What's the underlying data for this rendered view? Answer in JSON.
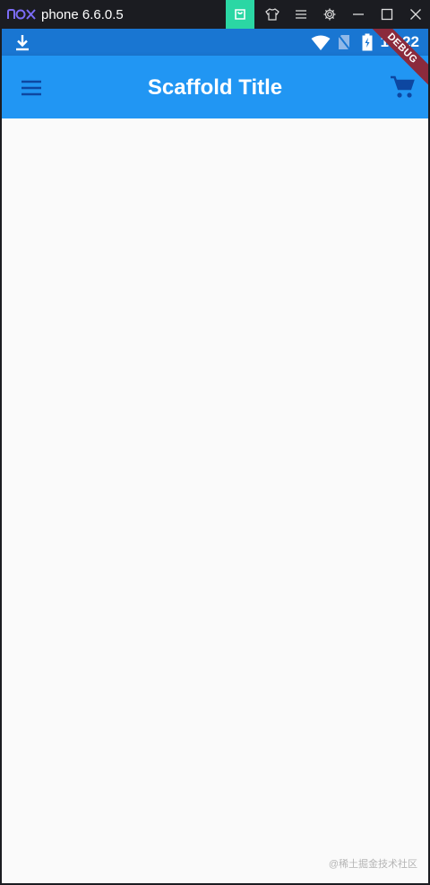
{
  "window": {
    "app_name": "nox",
    "title": "phone 6.6.0.5",
    "buttons": [
      "store-icon",
      "shirt-icon",
      "menu-icon",
      "gear-icon",
      "minimize-icon",
      "maximize-icon",
      "close-icon"
    ]
  },
  "statusbar": {
    "time": "10:22",
    "icons": [
      "download-icon",
      "wifi-icon",
      "no-sim-icon",
      "battery-charging-icon"
    ]
  },
  "appbar": {
    "title": "Scaffold Title",
    "leading_icon": "menu-icon",
    "action_icon": "shopping-cart-icon",
    "debug_banner": "DEBUG"
  },
  "colors": {
    "statusbar": "#1976d2",
    "appbar": "#2196f3",
    "body": "#fafafa",
    "store_button": "#2bd7a4",
    "debug_ribbon": "#8b2a3c"
  },
  "watermark": "@稀土掘金技术社区"
}
